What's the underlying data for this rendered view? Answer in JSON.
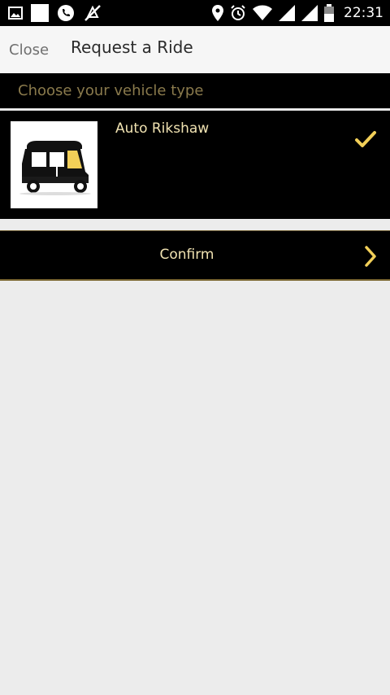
{
  "status_bar": {
    "time": "22:31",
    "left_icons": [
      "gallery-icon",
      "white-square-icon",
      "phone-icon",
      "no-sync-icon"
    ],
    "right_icons": [
      "location-pin-icon",
      "alarm-icon",
      "wifi-icon",
      "signal-icon",
      "signal-icon-2",
      "battery-icon"
    ]
  },
  "header": {
    "close_label": "Close",
    "title": "Request a Ride"
  },
  "section": {
    "label": "Choose your vehicle type"
  },
  "vehicles": [
    {
      "name": "Auto Rikshaw",
      "icon": "auto-rikshaw-icon",
      "selected": true
    }
  ],
  "confirm": {
    "label": "Confirm",
    "icon": "chevron-right-icon"
  },
  "colors": {
    "accent_gold": "#f2cf58",
    "text_gold": "#f1e3b2",
    "label_muted": "#8a7a4c",
    "dark_bg": "#000000",
    "light_bg": "#ececec"
  }
}
